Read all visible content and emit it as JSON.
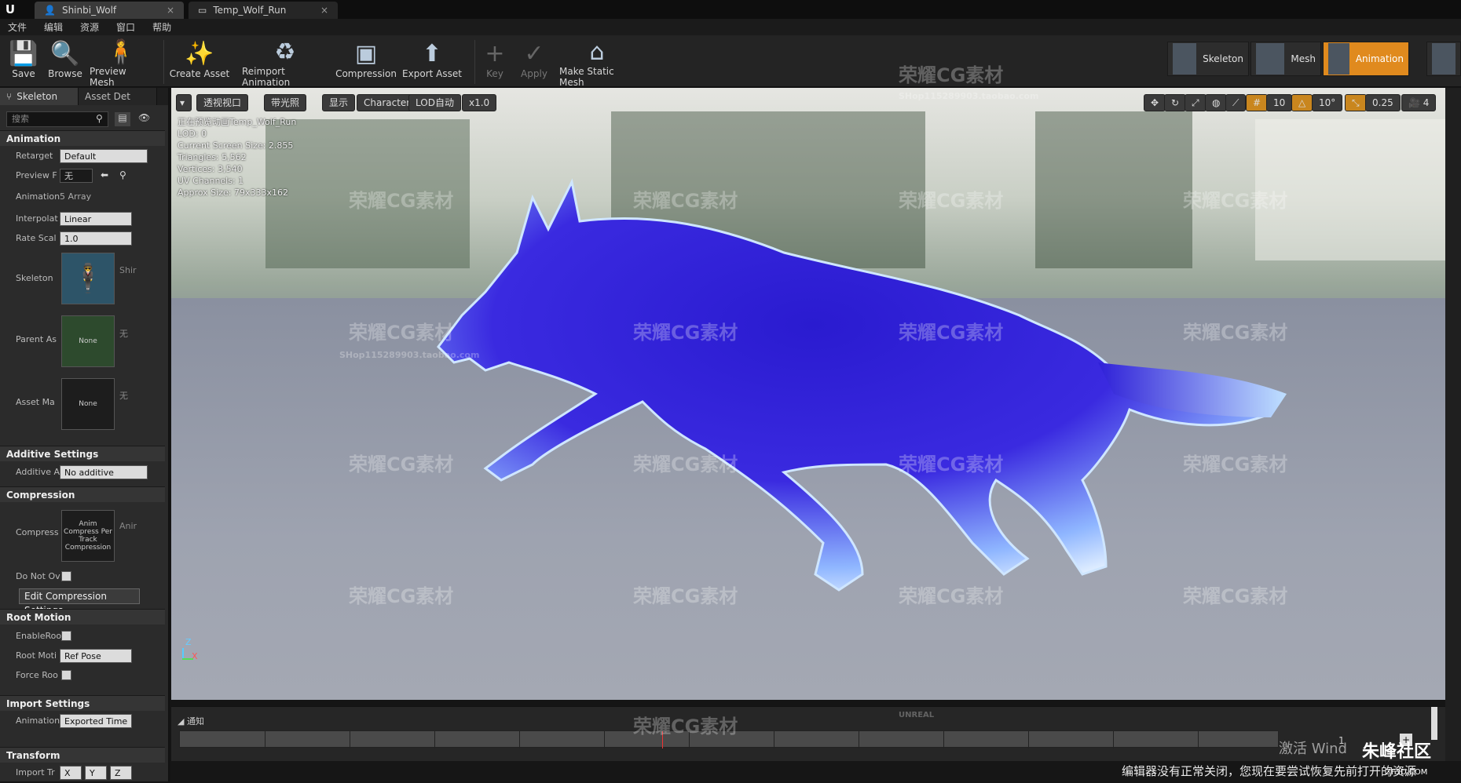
{
  "titlebar": {
    "tabs": [
      {
        "label": "Shinbi_Wolf"
      },
      {
        "label": "Temp_Wolf_Run"
      }
    ]
  },
  "menubar": [
    "文件",
    "编辑",
    "资源",
    "窗口",
    "帮助"
  ],
  "toolbar": {
    "buttons": [
      "Save",
      "Browse",
      "Preview Mesh",
      "Create Asset",
      "Reimport Animation",
      "Compression",
      "Export Asset",
      "Key",
      "Apply",
      "Make Static Mesh"
    ],
    "modes": [
      "Skeleton",
      "Mesh",
      "Animation"
    ]
  },
  "left_panel": {
    "tabs": [
      "Skeleton",
      "Asset Det"
    ],
    "search_placeholder": "搜索",
    "sections": {
      "animation": "Animation",
      "additive": "Additive Settings",
      "compression": "Compression",
      "root_motion": "Root Motion",
      "import": "Import Settings",
      "transform": "Transform"
    },
    "props": {
      "retarget_label": "Retarget",
      "retarget_value": "Default",
      "preview_label": "Preview F",
      "preview_value": "无",
      "animation_label": "Animation",
      "animation_value": "5 Array",
      "interp_label": "Interpolat",
      "interp_value": "Linear",
      "rate_label": "Rate Scal",
      "rate_value": "1.0",
      "skeleton_label": "Skeleton",
      "skeleton_value": "Shir",
      "parent_label": "Parent As",
      "parent_thumb": "None",
      "parent_value": "无",
      "assetmap_label": "Asset Ma",
      "assetmap_thumb": "None",
      "assetmap_value": "无",
      "additive_label": "Additive A",
      "additive_value": "No additive",
      "compress_label": "Compress",
      "compress_thumb": "Anim Compress Per Track Compression",
      "compress_value": "Anir",
      "donot_label": "Do Not Ov",
      "edit_compression": "Edit Compression Settings",
      "enableroot_label": "EnableRoo",
      "rootmotion_label": "Root Moti",
      "rootmotion_value": "Ref Pose",
      "forceroot_label": "Force Roo",
      "importanim_label": "Animation",
      "importanim_value": "Exported Time",
      "importtr_label": "Import Tr",
      "x": "X",
      "y": "Y",
      "z": "Z"
    }
  },
  "viewport": {
    "buttons": [
      "透视视口",
      "带光照",
      "显示",
      "Character",
      "LOD自动",
      "x1.0"
    ],
    "right_controls": [
      "10",
      "10°",
      "0.25",
      "4"
    ],
    "stats": [
      "正在预览动画Temp_Wolf_Run",
      "LOD: 0",
      "Current Screen Size: 2.855",
      "Triangles: 5,562",
      "Vertices: 3,540",
      "UV Channels: 1",
      "Approx Size: 79x333x162"
    ]
  },
  "timeline": {
    "label": "通知",
    "frame": "1"
  },
  "statusbar": {
    "activate": "激活 Wind",
    "message": "编辑器没有正常关闭，您现在要尝试恢复先前打开的资源",
    "brand": "朱峰社区",
    "brand_sub": "ZF3D.COM"
  },
  "watermark": {
    "text": "荣耀CG素材",
    "unreal": "UNREAL",
    "shop": "SHop115289903.taobao.com"
  },
  "colors": {
    "accent": "#e08a1e",
    "bg": "#242424"
  }
}
